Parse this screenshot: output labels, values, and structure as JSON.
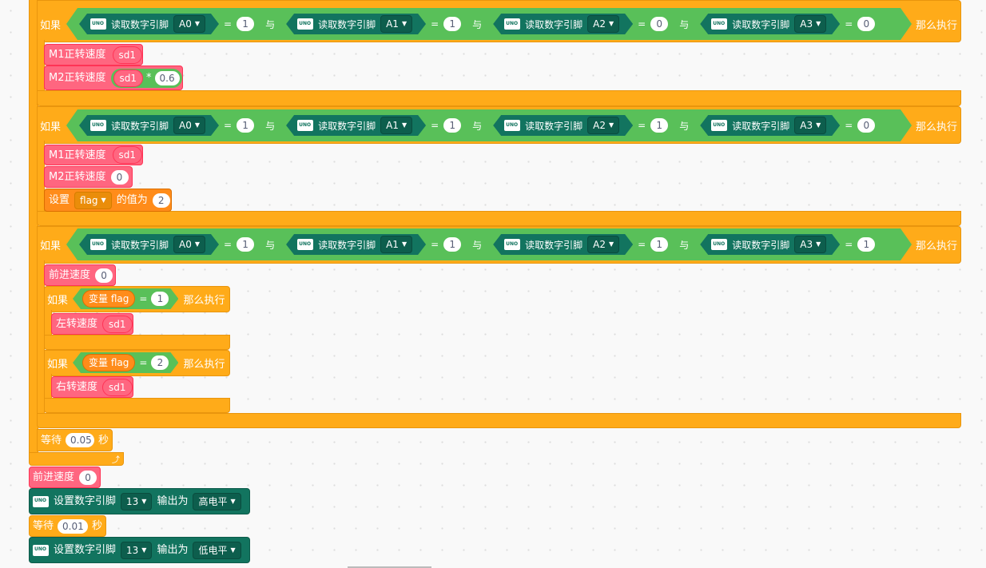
{
  "if_blocks": [
    {
      "if_label": "如果",
      "then_label": "那么执行",
      "and_label": "与",
      "conds": [
        {
          "read": "读取数字引脚",
          "pin": "A0",
          "eq": "=",
          "val": "1"
        },
        {
          "read": "读取数字引脚",
          "pin": "A1",
          "eq": "=",
          "val": "1"
        },
        {
          "read": "读取数字引脚",
          "pin": "A2",
          "eq": "=",
          "val": "0"
        },
        {
          "read": "读取数字引脚",
          "pin": "A3",
          "eq": "=",
          "val": "0"
        }
      ]
    },
    {
      "if_label": "如果",
      "then_label": "那么执行",
      "and_label": "与",
      "conds": [
        {
          "read": "读取数字引脚",
          "pin": "A0",
          "eq": "=",
          "val": "1"
        },
        {
          "read": "读取数字引脚",
          "pin": "A1",
          "eq": "=",
          "val": "1"
        },
        {
          "read": "读取数字引脚",
          "pin": "A2",
          "eq": "=",
          "val": "1"
        },
        {
          "read": "读取数字引脚",
          "pin": "A3",
          "eq": "=",
          "val": "0"
        }
      ]
    },
    {
      "if_label": "如果",
      "then_label": "那么执行",
      "and_label": "与",
      "conds": [
        {
          "read": "读取数字引脚",
          "pin": "A0",
          "eq": "=",
          "val": "1"
        },
        {
          "read": "读取数字引脚",
          "pin": "A1",
          "eq": "=",
          "val": "1"
        },
        {
          "read": "读取数字引脚",
          "pin": "A2",
          "eq": "=",
          "val": "1"
        },
        {
          "read": "读取数字引脚",
          "pin": "A3",
          "eq": "=",
          "val": "1"
        }
      ]
    }
  ],
  "b1": {
    "m1_label": "M1正转速度",
    "m1_val": "sd1",
    "m2_label": "M2正转速度",
    "m2_var": "sd1",
    "mul": "*",
    "m2_factor": "0.6"
  },
  "b2": {
    "m1_label": "M1正转速度",
    "m1_val": "sd1",
    "m2_label": "M2正转速度",
    "m2_val": "0",
    "set_label": "设置",
    "set_var": "flag",
    "set_mid": "的值为",
    "set_val": "2"
  },
  "b3": {
    "fwd_label": "前进速度",
    "fwd_val": "0",
    "inner1": {
      "if_label": "如果",
      "var_label": "变量 flag",
      "eq": "=",
      "val": "1",
      "then_label": "那么执行",
      "action": "左转速度",
      "action_val": "sd1"
    },
    "inner2": {
      "if_label": "如果",
      "var_label": "变量 flag",
      "eq": "=",
      "val": "2",
      "then_label": "那么执行",
      "action": "右转速度",
      "action_val": "sd1"
    }
  },
  "wait1": {
    "label": "等待",
    "val": "0.05",
    "unit": "秒"
  },
  "fwd_after": {
    "label": "前进速度",
    "val": "0"
  },
  "set13_high": {
    "label": "设置数字引脚",
    "pin": "13",
    "mid": "输出为",
    "level": "高电平"
  },
  "wait2": {
    "label": "等待",
    "val": "0.01",
    "unit": "秒"
  },
  "set13_low": {
    "label": "设置数字引脚",
    "pin": "13",
    "mid": "输出为",
    "level": "低电平"
  }
}
